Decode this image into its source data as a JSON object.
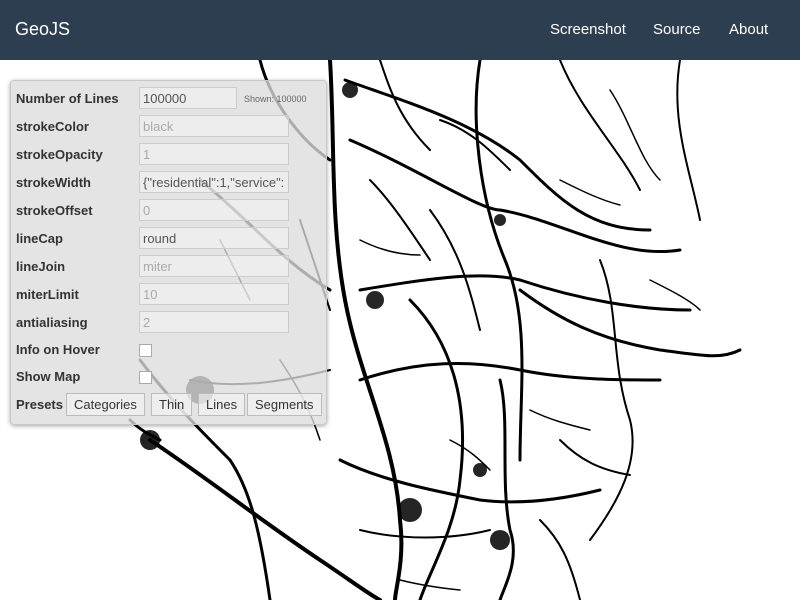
{
  "navbar": {
    "brand": "GeoJS",
    "links": [
      "Screenshot",
      "Source",
      "About"
    ]
  },
  "controls": {
    "number_of_lines": {
      "label": "Number of Lines",
      "value": "100000",
      "shown": "Shown: 100000"
    },
    "stroke_color": {
      "label": "strokeColor",
      "placeholder": "black"
    },
    "stroke_opacity": {
      "label": "strokeOpacity",
      "placeholder": "1"
    },
    "stroke_width": {
      "label": "strokeWidth",
      "value": "{\"residential\":1,\"service\":"
    },
    "stroke_offset": {
      "label": "strokeOffset",
      "placeholder": "0"
    },
    "line_cap": {
      "label": "lineCap",
      "value": "round"
    },
    "line_join": {
      "label": "lineJoin",
      "placeholder": "miter"
    },
    "miter_limit": {
      "label": "miterLimit",
      "placeholder": "10"
    },
    "antialiasing": {
      "label": "antialiasing",
      "placeholder": "2"
    },
    "info_on_hover": {
      "label": "Info on Hover"
    },
    "show_map": {
      "label": "Show Map"
    },
    "presets": {
      "label": "Presets",
      "buttons": [
        "Categories",
        "Thin",
        "Lines",
        "Segments"
      ]
    }
  },
  "map": {
    "line_color": "#000000",
    "background": "#ffffff"
  }
}
